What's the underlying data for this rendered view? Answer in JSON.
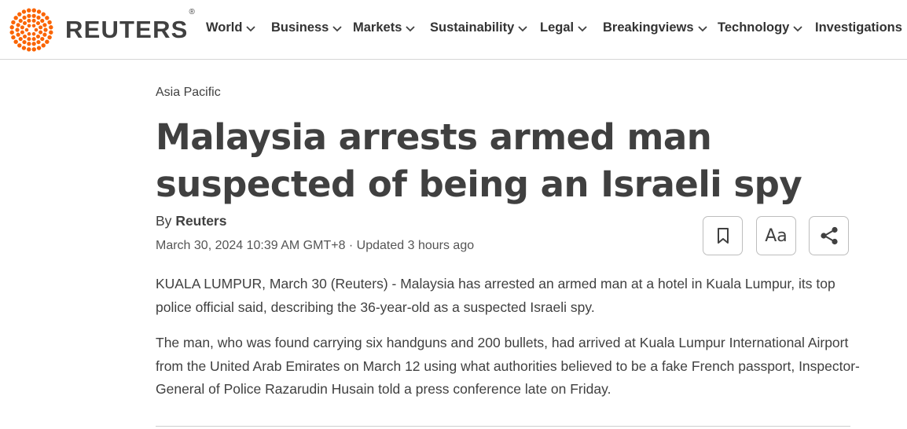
{
  "brand": {
    "name": "REUTERS",
    "reg": "®",
    "accent": "#fa6400"
  },
  "nav": {
    "items": [
      {
        "label": "World",
        "has_menu": true
      },
      {
        "label": "Business",
        "has_menu": true
      },
      {
        "label": "Markets",
        "has_menu": true
      },
      {
        "label": "Sustainability",
        "has_menu": true
      },
      {
        "label": "Legal",
        "has_menu": true
      },
      {
        "label": "Breakingviews",
        "has_menu": true
      },
      {
        "label": "Technology",
        "has_menu": true
      },
      {
        "label": "Investigations",
        "has_menu": false
      }
    ]
  },
  "article": {
    "section": "Asia Pacific",
    "headline": "Malaysia arrests armed man suspected of being an Israeli spy",
    "by_prefix": "By",
    "author": "Reuters",
    "dateline": "March 30, 2024 10:39 AM GMT+8 · Updated 3 hours ago",
    "tools": {
      "bookmark_icon": "bookmark-icon",
      "text_size_label": "Aa",
      "share_icon": "share-icon"
    },
    "paragraphs": [
      "KUALA LUMPUR, March 30 (Reuters) - Malaysia has arrested an armed man at a hotel in Kuala Lumpur, its top police official said, describing the 36-year-old as a suspected Israeli spy.",
      "The man, who was found carrying six handguns and 200 bullets, had arrived at Kuala Lumpur International Airport from the United Arab Emirates on March 12 using what authorities believed to be a fake French passport, Inspector-General of Police Razarudin Husain told a press conference late on Friday."
    ]
  }
}
